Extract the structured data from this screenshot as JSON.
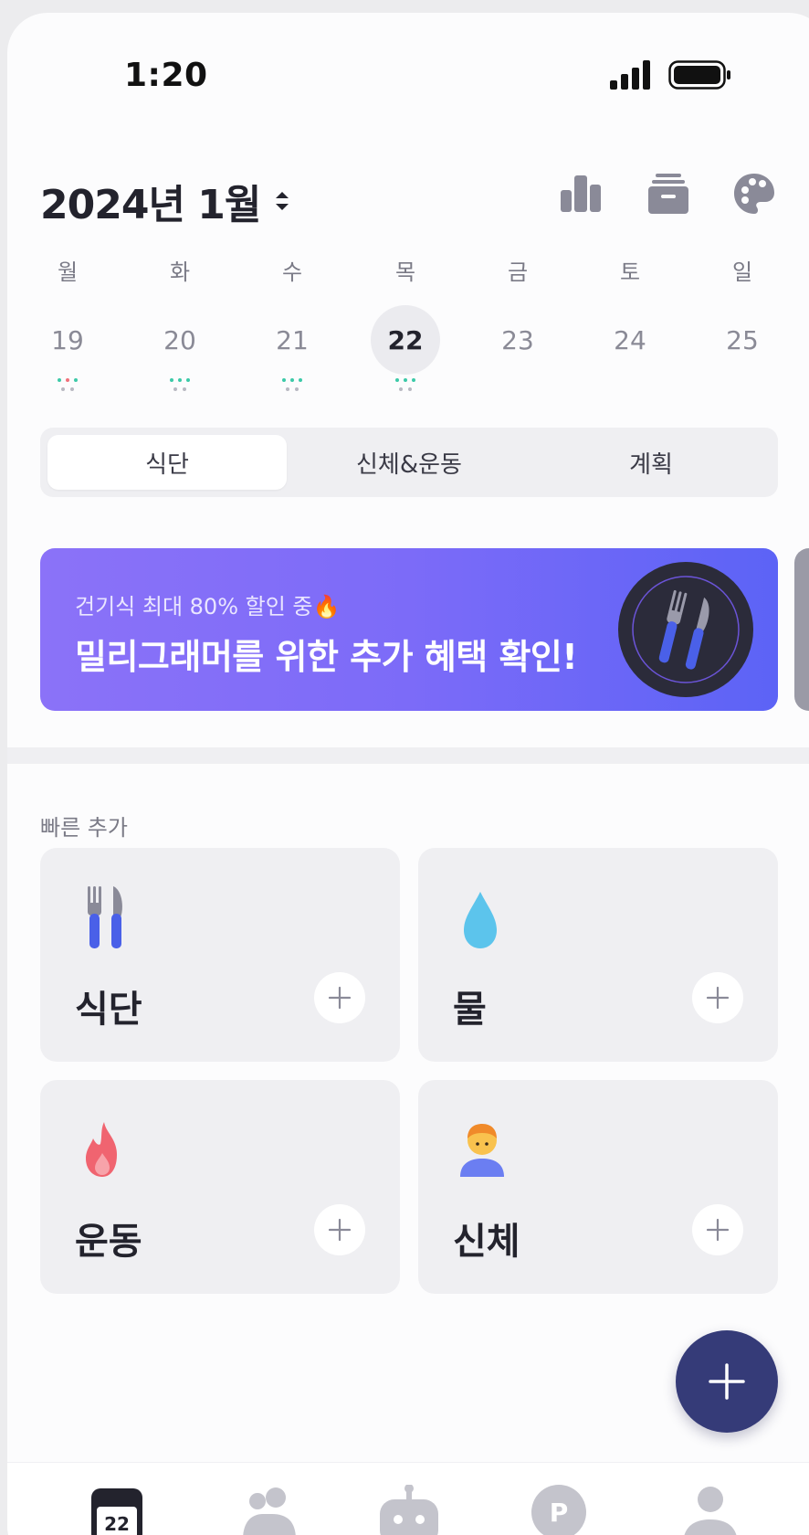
{
  "status_bar": {
    "time": "1:20"
  },
  "header": {
    "month_title": "2024년 1월"
  },
  "week": [
    {
      "name": "월",
      "num": "19",
      "selected": false,
      "dots": true
    },
    {
      "name": "화",
      "num": "20",
      "selected": false,
      "dots": true
    },
    {
      "name": "수",
      "num": "21",
      "selected": false,
      "dots": true
    },
    {
      "name": "목",
      "num": "22",
      "selected": true,
      "dots": true
    },
    {
      "name": "금",
      "num": "23",
      "selected": false,
      "dots": false
    },
    {
      "name": "토",
      "num": "24",
      "selected": false,
      "dots": false
    },
    {
      "name": "일",
      "num": "25",
      "selected": false,
      "dots": false
    }
  ],
  "segment": {
    "tabs": [
      "식단",
      "신체&운동",
      "계획"
    ],
    "active": 0
  },
  "banner": {
    "subtitle": "건기식 최대 80% 할인 중🔥",
    "title": "밀리그래머를 위한 추가 혜택 확인!"
  },
  "quick_add": {
    "label": "빠른 추가",
    "cards": [
      {
        "title": "식단",
        "icon": "fork-knife-icon"
      },
      {
        "title": "물",
        "icon": "water-drop-icon"
      },
      {
        "title": "운동",
        "icon": "flame-icon"
      },
      {
        "title": "신체",
        "icon": "person-icon"
      }
    ]
  },
  "tabbar": {
    "calendar_day": "22",
    "tabs": [
      "calendar-icon",
      "community-icon",
      "robot-icon",
      "points-icon",
      "profile-icon"
    ]
  },
  "colors": {
    "primary": "#353b78",
    "banner_start": "#8b72f8",
    "banner_end": "#5c63f6",
    "card_bg": "#efeff2",
    "dot_green": "#3cc9a8",
    "dot_red": "#f0707a",
    "dot_gray": "#b8b8c2"
  }
}
